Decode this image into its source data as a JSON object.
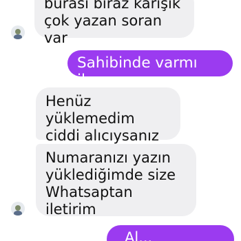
{
  "conversation": {
    "messages": [
      {
        "sender": "contact",
        "text": "burası biraz karışık\nçok yazan soran var"
      },
      {
        "sender": "me",
        "text": "Sahibinde varmı ilan"
      },
      {
        "sender": "contact",
        "text": "Henüz yüklemedim\nciddi alıcıysanız"
      },
      {
        "sender": "contact",
        "text": "Numaranızı yazın\nyüklediğimde size\nWhatsaptan iletirim"
      },
      {
        "sender": "me",
        "text": "Al..."
      }
    ],
    "avatar_icon": "contact-avatar",
    "colors": {
      "incoming_bubble": "#efeff1",
      "outgoing_bubble": "#9b3bf0",
      "incoming_text": "#111111",
      "outgoing_text": "#ffffff"
    }
  }
}
